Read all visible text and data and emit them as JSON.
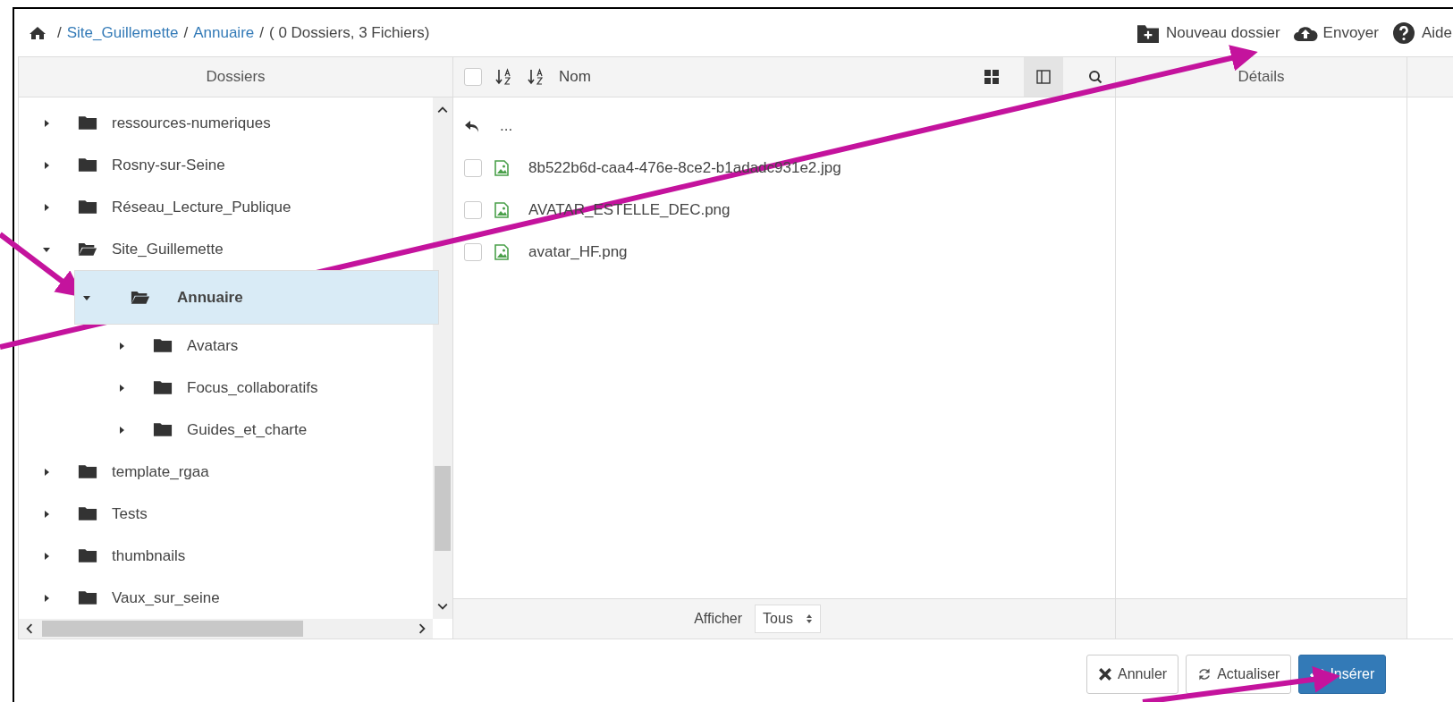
{
  "breadcrumb": {
    "items": [
      {
        "separator": "/",
        "label": "Site_Guillemette"
      },
      {
        "separator": "/",
        "label": "Annuaire"
      }
    ],
    "summary_separator": "/",
    "summary": "( 0 Dossiers, 3 Fichiers)"
  },
  "toolbar": [
    {
      "label": "Nouveau dossier",
      "kind": "new-folder"
    },
    {
      "label": "Envoyer",
      "kind": "upload"
    },
    {
      "label": "Aide",
      "kind": "help"
    }
  ],
  "folders_panel": {
    "title": "Dossiers",
    "tree": [
      {
        "label": "ressources-numeriques",
        "expanded": false,
        "selected": false
      },
      {
        "label": "Rosny-sur-Seine",
        "expanded": false,
        "selected": false
      },
      {
        "label": "Réseau_Lecture_Publique",
        "expanded": false,
        "selected": false
      },
      {
        "label": "Site_Guillemette",
        "expanded": true,
        "selected": false,
        "children": [
          {
            "label": "Annuaire",
            "expanded": true,
            "selected": true,
            "children": [
              {
                "label": "Avatars",
                "expanded": false,
                "selected": false
              },
              {
                "label": "Focus_collaboratifs",
                "expanded": false,
                "selected": false
              },
              {
                "label": "Guides_et_charte",
                "expanded": false,
                "selected": false
              }
            ]
          }
        ]
      },
      {
        "label": "template_rgaa",
        "expanded": false,
        "selected": false
      },
      {
        "label": "Tests",
        "expanded": false,
        "selected": false
      },
      {
        "label": "thumbnails",
        "expanded": false,
        "selected": false
      },
      {
        "label": "Vaux_sur_seine",
        "expanded": false,
        "selected": false
      }
    ]
  },
  "files_panel": {
    "select_all": {
      "checked": false
    },
    "sort_label": "Nom",
    "view_buttons": [
      {
        "kind": "grid",
        "selected": false
      },
      {
        "kind": "columns",
        "selected": true
      },
      {
        "kind": "search",
        "selected": false
      }
    ],
    "parent_row": "...",
    "files": [
      {
        "name": "8b522b6d-caa4-476e-8ce2-b1adadc931e2.jpg",
        "checked": false
      },
      {
        "name": "AVATAR_ESTELLE_DEC.png",
        "checked": false
      },
      {
        "name": "avatar_HF.png",
        "checked": false
      }
    ],
    "footer": {
      "label": "Afficher",
      "select": "Tous"
    }
  },
  "details_panel": {
    "title": "Détails"
  },
  "buttons": [
    {
      "label": "Annuler",
      "kind": "cancel",
      "primary": false
    },
    {
      "label": "Actualiser",
      "kind": "refresh",
      "primary": false
    },
    {
      "label": "Insérer",
      "kind": "insert",
      "primary": true
    }
  ]
}
